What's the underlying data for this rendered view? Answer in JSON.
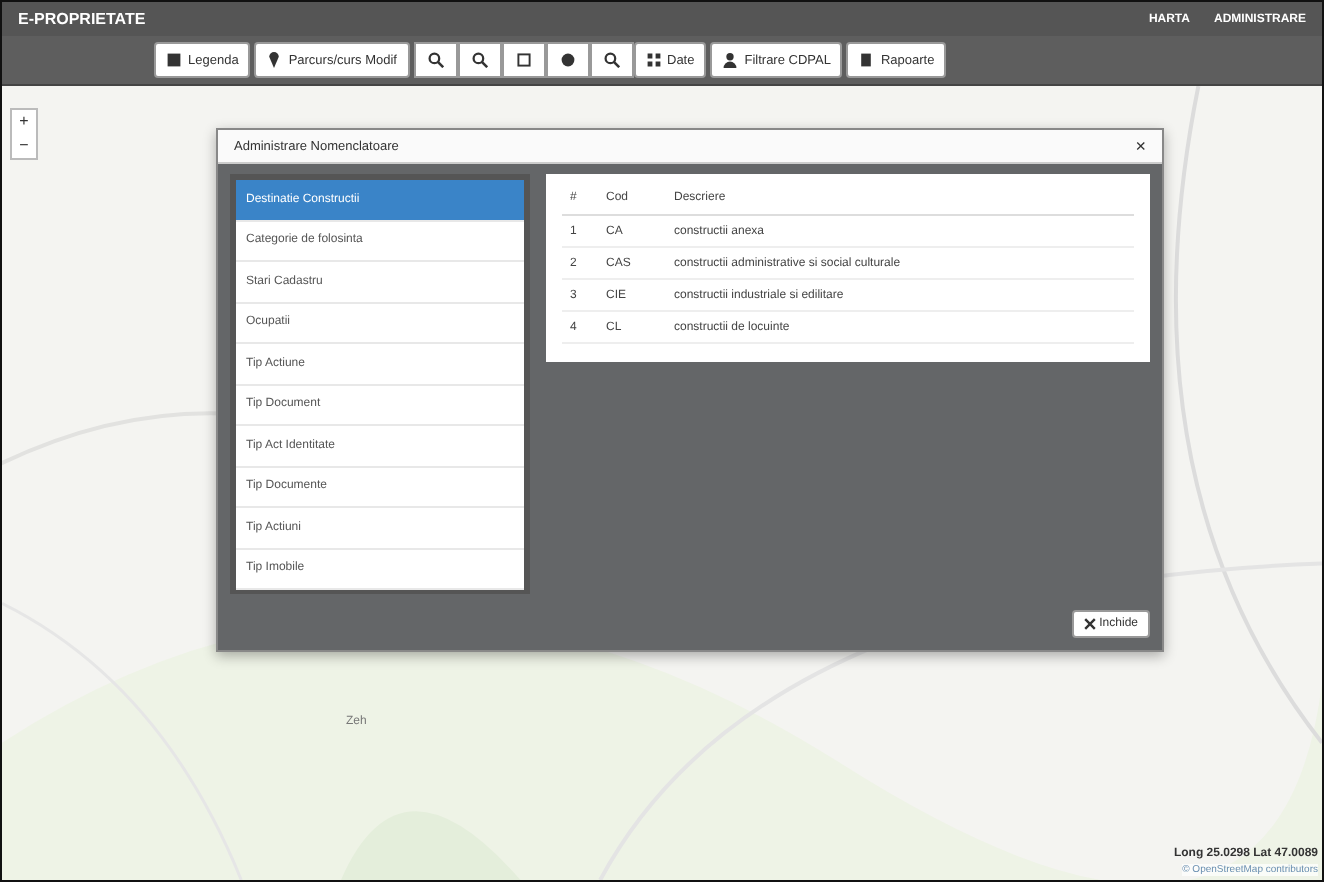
{
  "app": {
    "title": "E-PROPRIETATE",
    "nav": [
      {
        "label": "HARTA"
      },
      {
        "label": "ADMINISTRARE"
      }
    ]
  },
  "toolbar": [
    {
      "kind": "text",
      "label": "Legenda"
    },
    {
      "kind": "text",
      "label": "Parcurs/curs Modif"
    },
    {
      "kind": "icon"
    },
    {
      "kind": "icon"
    },
    {
      "kind": "icon"
    },
    {
      "kind": "icon"
    },
    {
      "kind": "icon"
    },
    {
      "kind": "text",
      "label": "Date"
    },
    {
      "kind": "text",
      "label": "Filtrare CDPAL"
    },
    {
      "kind": "text",
      "label": "Rapoarte"
    }
  ],
  "map": {
    "zoom": [
      "+",
      "−"
    ],
    "place_label": "Zeh",
    "coordinates": "Long 25.0298 Lat 47.0089",
    "attribution": "© OpenStreetMap contributors"
  },
  "dialog": {
    "title": "Administrare Nomenclatoare",
    "close": "×",
    "list": [
      {
        "label": "Destinatie Constructii",
        "selected": true
      },
      {
        "label": "Categorie de folosinta",
        "selected": false
      },
      {
        "label": "Stari Cadastru",
        "selected": false
      },
      {
        "label": "Ocupatii",
        "selected": false
      },
      {
        "label": "Tip Actiune",
        "selected": false
      },
      {
        "label": "Tip Document",
        "selected": false
      },
      {
        "label": "Tip Act Identitate",
        "selected": false
      },
      {
        "label": "Tip Documente",
        "selected": false
      },
      {
        "label": "Tip Actiuni",
        "selected": false
      },
      {
        "label": "Tip Imobile",
        "selected": false
      }
    ],
    "table": {
      "columns": [
        "#",
        "Cod",
        "Descriere"
      ],
      "rows": [
        [
          "1",
          "CA",
          "constructii anexa"
        ],
        [
          "2",
          "CAS",
          "constructii administrative si social culturale"
        ],
        [
          "3",
          "CIE",
          "constructii industriale si edilitare"
        ],
        [
          "4",
          "CL",
          "constructii de locuinte"
        ]
      ]
    },
    "button": "Inchide"
  }
}
